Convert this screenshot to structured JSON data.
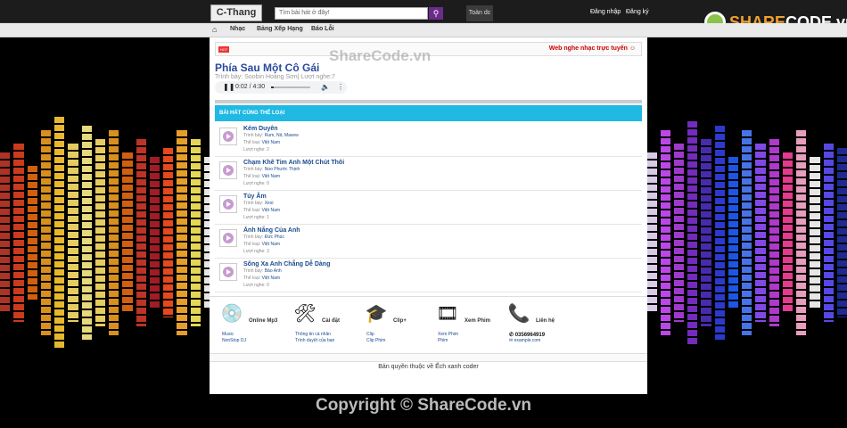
{
  "header": {
    "logo_text": "C-Thang",
    "search_placeholder": "Tìm bài hát ở đây!",
    "search_icon": "magnifier-icon",
    "top_button": "Toàn dc",
    "login": "Đăng nhập",
    "register": "Đăng ký",
    "brand_prefix": "SHARE",
    "brand_suffix": "CODE.vn"
  },
  "nav": {
    "home_icon": "house-icon",
    "items": [
      "Nhạc",
      "Bảng Xếp Hạng",
      "Báo Lỗi"
    ]
  },
  "marquee": {
    "badge": "HOT",
    "text": "Web nghe nhạc trực tuyến ☺"
  },
  "now_playing": {
    "title": "Phía Sau Một Cô Gái",
    "meta": "Trình bày: Soobin Hoàng Sơn| Lượt nghe:7",
    "time": "0:02 / 4:30",
    "progress": 0.0074
  },
  "section_title": "BÀI HÁT CÙNG THỂ LOẠI",
  "songs": [
    {
      "title": "Kém Duyên",
      "artist": "Rum, Nit, Masew",
      "genre": "Việt Nam",
      "plays": "2"
    },
    {
      "title": "Chạm Khẽ Tim Anh Một Chút Thôi",
      "artist": "Noo Phước Thịnh",
      "genre": "Việt Nam",
      "plays": "0"
    },
    {
      "title": "Túy Âm",
      "artist": "Xesi",
      "genre": "Việt Nam",
      "plays": "1"
    },
    {
      "title": "Ánh Nắng Của Anh",
      "artist": "Đức Phúc",
      "genre": "Việt Nam",
      "plays": "3"
    },
    {
      "title": "Sống Xa Anh Chẳng Dễ Dàng",
      "artist": "Bảo Anh",
      "genre": "Việt Nam",
      "plays": "0"
    }
  ],
  "labels": {
    "artist": "Trình bày: ",
    "genre": "Thể loại: ",
    "plays": "Lượt nghe: "
  },
  "footer_cols": [
    {
      "icon": "cd-disc-icon",
      "title": "Online Mp3",
      "l1": "Music",
      "l2": "NonStop DJ"
    },
    {
      "icon": "tools-icon",
      "title": "Cài đặt",
      "l1": "Thông tin cá nhân",
      "l2": "Trình duyệt của bạn"
    },
    {
      "icon": "graduation-cap-icon",
      "title": "Clip+",
      "l1": "Clip",
      "l2": "Clip Phim"
    },
    {
      "icon": "film-reel-icon",
      "title": "Xem Phim",
      "l1": "Xem Phim",
      "l2": "Phim"
    },
    {
      "icon": "phone-icon",
      "title": "Liên hệ",
      "phone": "0356964919",
      "email": "example.com"
    }
  ],
  "copyright_inner": "Bản quyền thuộc về Ếch xanh coder",
  "watermark_top": "ShareCode.vn",
  "watermark_bottom": "Copyright © ShareCode.vn"
}
